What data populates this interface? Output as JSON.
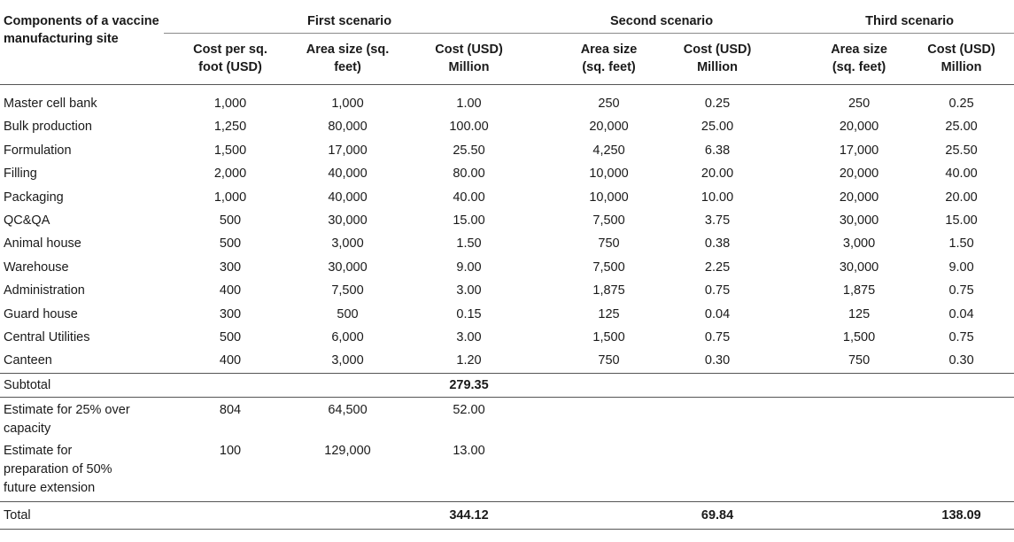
{
  "header": {
    "component_label": "Components of a vaccine manufacturing site",
    "groups": [
      "First scenario",
      "Second scenario",
      "Third scenario"
    ],
    "subcolumns": [
      "Cost per sq. foot (USD)",
      "Area size (sq. feet)",
      "Cost (USD) Million",
      "Area size (sq. feet)",
      "Cost (USD) Million",
      "Area size (sq. feet)",
      "Cost (USD) Million"
    ]
  },
  "rows": [
    {
      "label": "Master cell bank",
      "cells": [
        "1,000",
        "1,000",
        "1.00",
        "250",
        "0.25",
        "250",
        "0.25"
      ]
    },
    {
      "label": "Bulk production",
      "cells": [
        "1,250",
        "80,000",
        "100.00",
        "20,000",
        "25.00",
        "20,000",
        "25.00"
      ]
    },
    {
      "label": "Formulation",
      "cells": [
        "1,500",
        "17,000",
        "25.50",
        "4,250",
        "6.38",
        "17,000",
        "25.50"
      ]
    },
    {
      "label": "Filling",
      "cells": [
        "2,000",
        "40,000",
        "80.00",
        "10,000",
        "20.00",
        "20,000",
        "40.00"
      ]
    },
    {
      "label": "Packaging",
      "cells": [
        "1,000",
        "40,000",
        "40.00",
        "10,000",
        "10.00",
        "20,000",
        "20.00"
      ]
    },
    {
      "label": "QC&QA",
      "cells": [
        "500",
        "30,000",
        "15.00",
        "7,500",
        "3.75",
        "30,000",
        "15.00"
      ]
    },
    {
      "label": "Animal house",
      "cells": [
        "500",
        "3,000",
        "1.50",
        "750",
        "0.38",
        "3,000",
        "1.50"
      ]
    },
    {
      "label": "Warehouse",
      "cells": [
        "300",
        "30,000",
        "9.00",
        "7,500",
        "2.25",
        "30,000",
        "9.00"
      ]
    },
    {
      "label": "Administration",
      "cells": [
        "400",
        "7,500",
        "3.00",
        "1,875",
        "0.75",
        "1,875",
        "0.75"
      ]
    },
    {
      "label": "Guard house",
      "cells": [
        "300",
        "500",
        "0.15",
        "125",
        "0.04",
        "125",
        "0.04"
      ]
    },
    {
      "label": "Central Utilities",
      "cells": [
        "500",
        "6,000",
        "3.00",
        "1,500",
        "0.75",
        "1,500",
        "0.75"
      ]
    },
    {
      "label": "Canteen",
      "cells": [
        "400",
        "3,000",
        "1.20",
        "750",
        "0.30",
        "750",
        "0.30"
      ]
    }
  ],
  "subtotal": {
    "label": "Subtotal",
    "value": "279.35"
  },
  "extras": [
    {
      "label": "Estimate for 25% over capacity",
      "cells": [
        "804",
        "64,500",
        "52.00"
      ]
    },
    {
      "label": "Estimate for preparation of 50% future extension",
      "cells": [
        "100",
        "129,000",
        "13.00"
      ]
    }
  ],
  "total": {
    "label": "Total",
    "first": "344.12",
    "second": "69.84",
    "third": "138.09"
  }
}
